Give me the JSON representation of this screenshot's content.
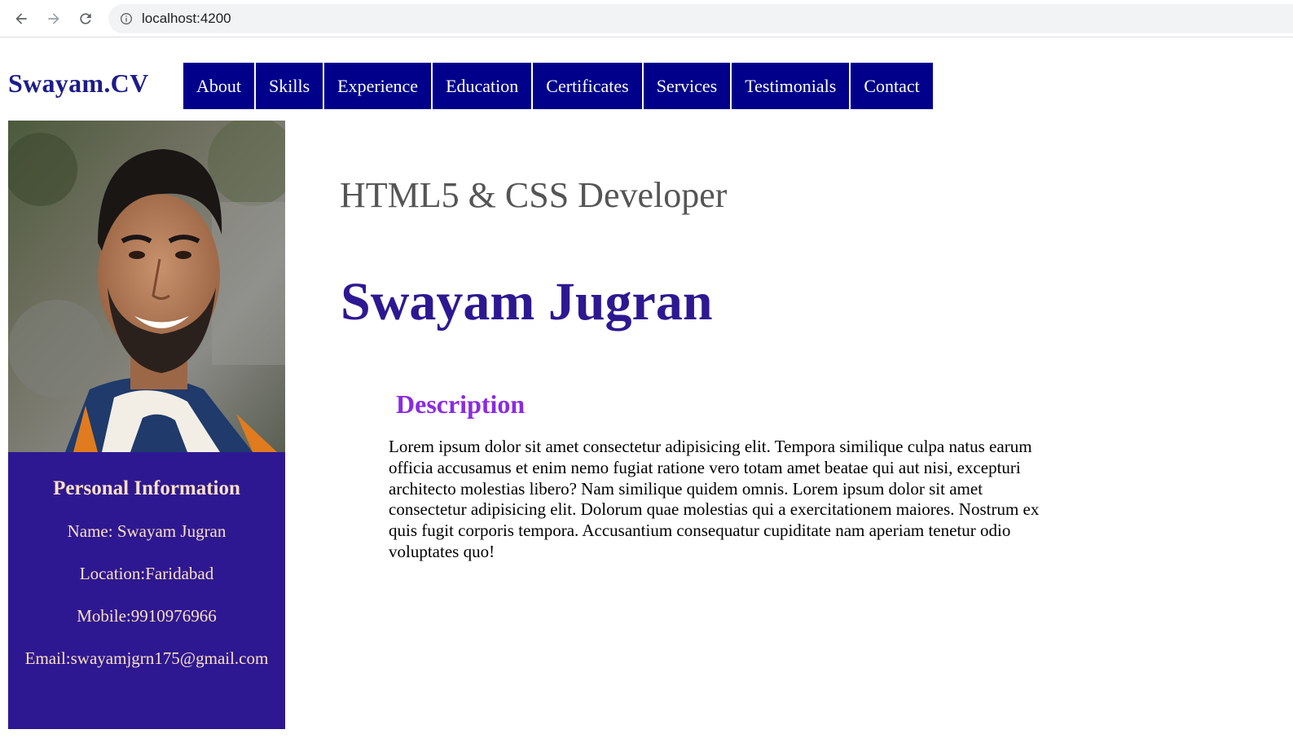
{
  "browser": {
    "url": "localhost:4200"
  },
  "header": {
    "logo": "Swayam.CV",
    "nav": [
      {
        "label": "About"
      },
      {
        "label": "Skills"
      },
      {
        "label": "Experience"
      },
      {
        "label": "Education"
      },
      {
        "label": "Certificates"
      },
      {
        "label": "Services"
      },
      {
        "label": "Testimonials"
      },
      {
        "label": "Contact"
      }
    ]
  },
  "sidebar": {
    "heading": "Personal Information",
    "name": "Name: Swayam Jugran",
    "location": "Location:Faridabad",
    "mobile": "Mobile:9910976966",
    "email": "Email:swayamjgrn175@gmail.com"
  },
  "main": {
    "role": "HTML5 & CSS Developer",
    "name": "Swayam Jugran",
    "description_heading": "Description",
    "description": "Lorem ipsum dolor sit amet consectetur adipisicing elit. Tempora similique culpa natus earum officia accusamus et enim nemo fugiat ratione vero totam amet beatae qui aut nisi, excepturi architecto molestias libero? Nam similique quidem omnis. Lorem ipsum dolor sit amet consectetur adipisicing elit. Dolorum quae molestias qui a exercitationem maiores. Nostrum ex quis fugit corporis tempora. Accusantium consequatur cupiditate nam aperiam tenetur odio voluptates quo!"
  },
  "colors": {
    "nav_bg": "#00008b",
    "logo": "#1c1c8a",
    "panel_bg": "#2e1891",
    "panel_text": "#f9e0c4",
    "name": "#2e1891",
    "desc_heading": "#8a2be2"
  }
}
